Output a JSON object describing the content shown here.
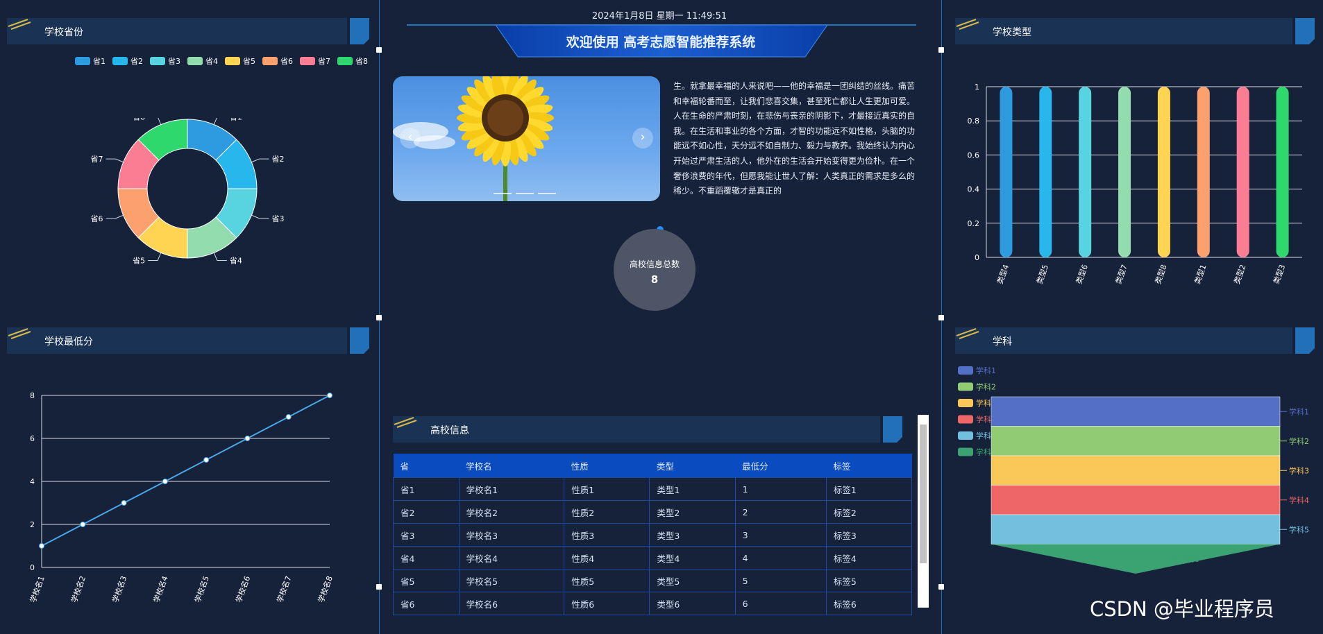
{
  "datetime": "2024年1月8日 星期一 11:49:51",
  "banner_title": "欢迎使用 高考志愿智能推荐系统",
  "panels": {
    "province": "学校省份",
    "minscore": "学校最低分",
    "type": "学校类型",
    "subject": "学科",
    "info": "高校信息"
  },
  "intro_text": "生。就拿最幸福的人来说吧——他的幸福是一团纠结的丝线。痛苦和幸福轮番而至，让我们悲喜交集，甚至死亡都让人生更加可爱。人在生命的严肃时刻，在悲伤与丧亲的阴影下，才最接近真实的自我。在生活和事业的各个方面，才智的功能远不如性格，头脑的功能远不如心性，天分远不如自制力、毅力与教养。我始终认为内心开始过严肃生活的人，他外在的生活会开始变得更为俭朴。在一个奢侈浪费的年代，但愿我能让世人了解：人类真正的需求是多么的稀少。不重蹈覆辙才是真正的",
  "total": {
    "label": "高校信息总数",
    "value": "8"
  },
  "carousel": {
    "prev": "‹",
    "next": "›"
  },
  "table": {
    "headers": [
      "省",
      "学校名",
      "性质",
      "类型",
      "最低分",
      "标签"
    ],
    "rows": [
      [
        "省1",
        "学校名1",
        "性质1",
        "类型1",
        "1",
        "标签1"
      ],
      [
        "省2",
        "学校名2",
        "性质2",
        "类型2",
        "2",
        "标签2"
      ],
      [
        "省3",
        "学校名3",
        "性质3",
        "类型3",
        "3",
        "标签3"
      ],
      [
        "省4",
        "学校名4",
        "性质4",
        "类型4",
        "4",
        "标签4"
      ],
      [
        "省5",
        "学校名5",
        "性质5",
        "类型5",
        "5",
        "标签5"
      ],
      [
        "省6",
        "学校名6",
        "性质6",
        "类型6",
        "6",
        "标签6"
      ]
    ]
  },
  "watermark": "CSDN @毕业程序员",
  "colors": {
    "c1": "#2e9ae0",
    "c2": "#28b7ec",
    "c3": "#58d3e0",
    "c4": "#93dcae",
    "c5": "#fed452",
    "c6": "#fca16e",
    "c7": "#fb7d93",
    "c8": "#2fd86c"
  },
  "chart_data": [
    {
      "type": "pie",
      "donut": true,
      "legend": [
        "省1",
        "省2",
        "省3",
        "省4",
        "省5",
        "省6",
        "省7",
        "省8"
      ],
      "categories": [
        "省1",
        "省2",
        "省3",
        "省4",
        "省5",
        "省6",
        "省7",
        "省8"
      ],
      "values": [
        1,
        1,
        1,
        1,
        1,
        1,
        1,
        1
      ],
      "legend_position": "top-right"
    },
    {
      "type": "line",
      "x": [
        "学校名1",
        "学校名2",
        "学校名3",
        "学校名4",
        "学校名5",
        "学校名6",
        "学校名7",
        "学校名8"
      ],
      "values": [
        1,
        2,
        3,
        4,
        5,
        6,
        7,
        8
      ],
      "ylim": [
        0,
        8
      ],
      "yticks": [
        0,
        2,
        4,
        6,
        8
      ],
      "grid": true
    },
    {
      "type": "bar",
      "categories": [
        "类型4",
        "类型5",
        "类型6",
        "类型7",
        "类型8",
        "类型1",
        "类型2",
        "类型3"
      ],
      "values": [
        1,
        1,
        1,
        1,
        1,
        1,
        1,
        1
      ],
      "ylim": [
        0,
        1
      ],
      "yticks": [
        "0",
        "0.2",
        "0.4",
        "0.6",
        "0.8",
        "1"
      ],
      "grid": true
    },
    {
      "type": "funnel",
      "legend": [
        "学科1",
        "学科2",
        "学科3",
        "学科4",
        "学科5",
        "学科6"
      ],
      "categories": [
        "学科1",
        "学科2",
        "学科3",
        "学科4",
        "学科5",
        "学科6"
      ],
      "values": [
        1,
        1,
        1,
        1,
        1,
        1
      ],
      "colors": [
        "#5470c6",
        "#91cc75",
        "#fac858",
        "#ee6666",
        "#73c0de",
        "#3ba272"
      ],
      "legend_position": "top-left"
    }
  ]
}
